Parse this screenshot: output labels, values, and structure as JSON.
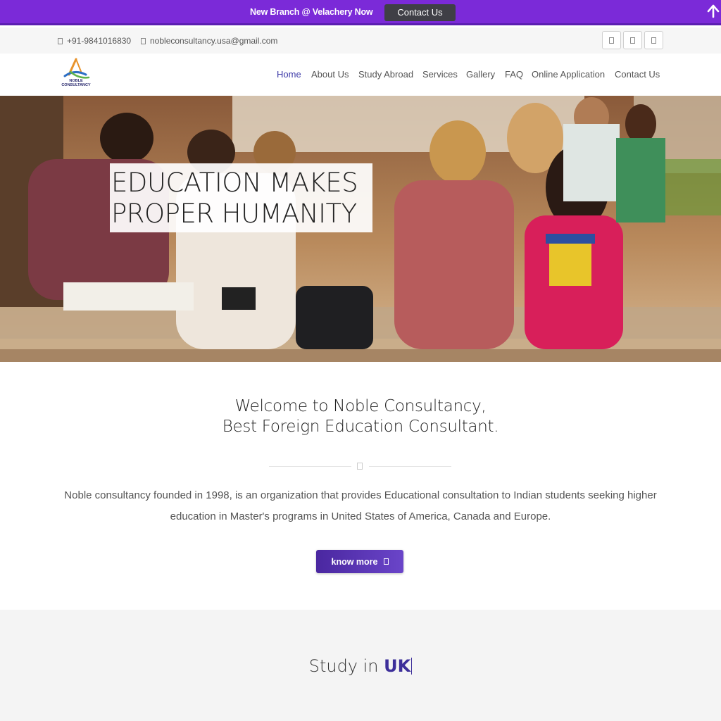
{
  "promo": {
    "text": "New Branch @ Velachery Now",
    "button_label": "Contact Us"
  },
  "topbar": {
    "phone": "+91-9841016830",
    "email": "nobleconsultancy.usa@gmail.com",
    "social_icons": [
      "social-icon-1",
      "social-icon-2",
      "social-icon-3"
    ]
  },
  "brand": {
    "logo_line1": "NOBLE",
    "logo_line2": "CONSULTANCY"
  },
  "nav": {
    "items": [
      "Home",
      "About Us",
      "Study Abroad",
      "Services",
      "Gallery",
      "FAQ",
      "Online Application",
      "Contact Us"
    ],
    "active": "Home"
  },
  "hero": {
    "line1": "EDUCATION MAKES",
    "line2": "PROPER HUMANITY"
  },
  "welcome": {
    "heading_line1": "Welcome to Noble Consultancy,",
    "heading_line2": "Best Foreign Education Consultant.",
    "paragraph": "Noble consultancy founded in 1998, is an organization that provides Educational consultation to Indian students seeking higher education in Master's programs in United States of America, Canada and Europe.",
    "button_label": "know more"
  },
  "study": {
    "prefix": "Study in",
    "country": "UK"
  },
  "colors": {
    "brand_purple": "#7b2ad8",
    "button_purple": "#4a27a0",
    "accent_text": "#3d2f9a"
  }
}
